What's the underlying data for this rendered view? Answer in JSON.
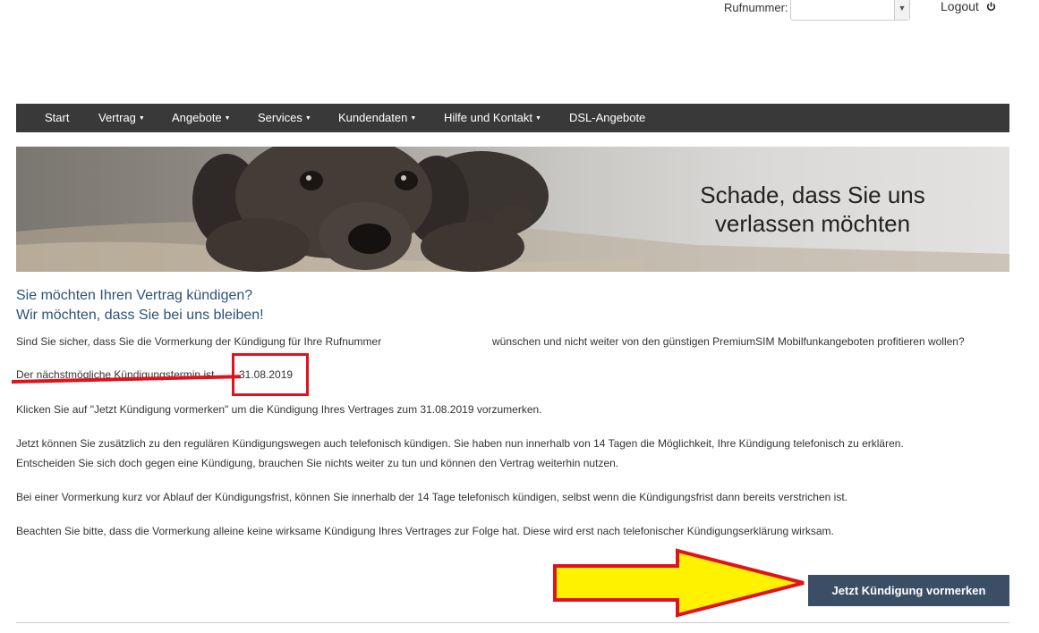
{
  "topbar": {
    "rufnummer_label": "Rufnummer:",
    "rufnummer_value": "",
    "logout_label": "Logout"
  },
  "nav": {
    "items": [
      {
        "label": "Start",
        "dropdown": false
      },
      {
        "label": "Vertrag",
        "dropdown": true
      },
      {
        "label": "Angebote",
        "dropdown": true
      },
      {
        "label": "Services",
        "dropdown": true
      },
      {
        "label": "Kundendaten",
        "dropdown": true
      },
      {
        "label": "Hilfe und Kontakt",
        "dropdown": true
      },
      {
        "label": "DSL-Angebote",
        "dropdown": false
      }
    ]
  },
  "banner": {
    "line1": "Schade, dass Sie uns",
    "line2": "verlassen möchten"
  },
  "content": {
    "heading1": "Sie möchten Ihren Vertrag kündigen?",
    "heading2": "Wir möchten, dass Sie bei uns bleiben!",
    "question_part1": "Sind Sie sicher, dass Sie die Vormerkung der Kündigung für Ihre Rufnummer",
    "question_part2": "wünschen und nicht weiter von den günstigen PremiumSIM Mobilfunkangeboten profitieren wollen?",
    "termin_label": "Der nächstmögliche Kündigungstermin ist",
    "termin_date": "31.08.2019",
    "click_text": "Klicken Sie auf \"Jetzt Kündigung vormerken\" um die Kündigung Ihres Vertrages zum 31.08.2019 vorzumerken.",
    "phone_text_1": "Jetzt können Sie zusätzlich zu den regulären Kündigungswegen auch telefonisch kündigen. Sie haben nun innerhalb von 14 Tagen die Möglichkeit, Ihre Kündigung telefonisch zu erklären.",
    "phone_text_2": "Entscheiden Sie sich doch gegen eine Kündigung, brauchen Sie nichts weiter zu tun und können den Vertrag weiterhin nutzen.",
    "frist_text": "Bei einer Vormerkung kurz vor Ablauf der Kündigungsfrist, können Sie innerhalb der 14 Tage telefonisch kündigen, selbst wenn die Kündigungsfrist dann bereits verstrichen ist.",
    "note_text": "Beachten Sie bitte, dass die Vormerkung alleine keine wirksame Kündigung Ihres Vertrages zur Folge hat. Diese wird erst nach telefonischer Kündigungserklärung wirksam.",
    "submit_label": "Jetzt Kündigung vormerken"
  },
  "colors": {
    "nav_bg": "#393939",
    "heading": "#2d5377",
    "button_bg": "#3a4f66",
    "annotation_red": "#e0121b",
    "annotation_yellow": "#fff200"
  }
}
